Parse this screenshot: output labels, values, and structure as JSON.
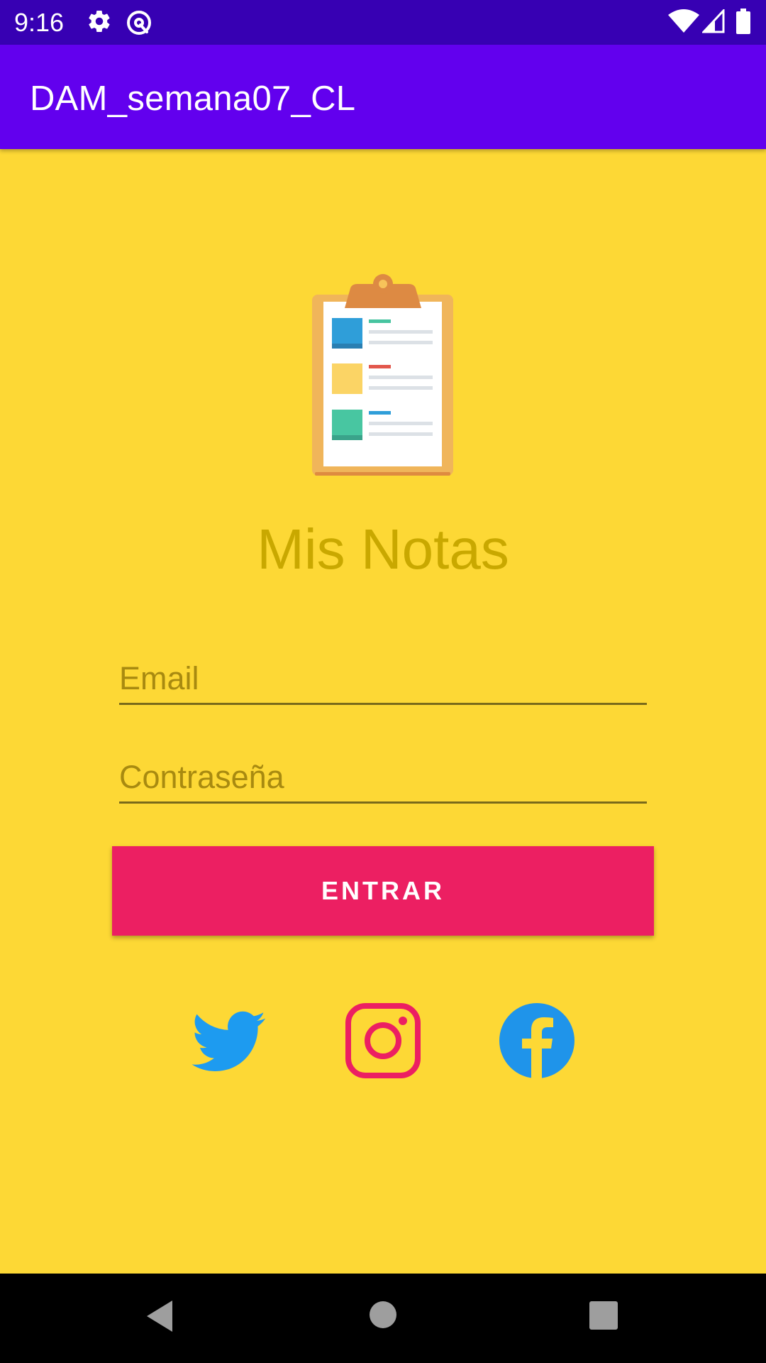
{
  "status_bar": {
    "time": "9:16",
    "icons": [
      "gear-icon",
      "at-sync-icon",
      "wifi-icon",
      "signal-icon",
      "battery-icon"
    ]
  },
  "app_bar": {
    "title": "DAM_semana07_CL",
    "color": "#6200EE"
  },
  "main": {
    "logo_icon": "clipboard-icon",
    "title": "Mis Notas",
    "email": {
      "placeholder": "Email",
      "value": ""
    },
    "password": {
      "placeholder": "Contraseña",
      "value": ""
    },
    "login_button": {
      "label": "ENTRAR",
      "color": "#EC1F62"
    },
    "social_icons": [
      "twitter-icon",
      "instagram-icon",
      "facebook-icon"
    ],
    "background_color": "#FDD835"
  },
  "nav_bar": {
    "icons": [
      "back-icon",
      "home-icon",
      "recents-icon"
    ]
  }
}
